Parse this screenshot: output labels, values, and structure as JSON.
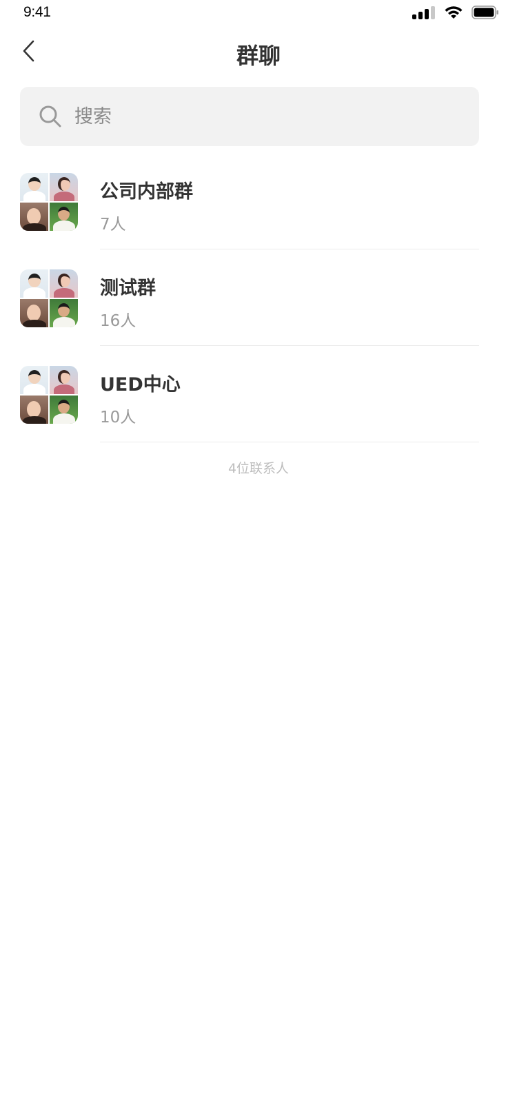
{
  "status_bar": {
    "time": "9:41"
  },
  "nav": {
    "title": "群聊"
  },
  "search": {
    "placeholder": "搜索"
  },
  "groups": [
    {
      "name": "公司内部群",
      "count": "7人"
    },
    {
      "name": "测试群",
      "count": "16人"
    },
    {
      "name": "UED中心",
      "count": "10人"
    }
  ],
  "footer": {
    "contacts_count": "4位联系人"
  },
  "icons": {
    "back": "chevron-left-icon",
    "search": "search-icon",
    "signal": "signal-icon",
    "wifi": "wifi-icon",
    "battery": "battery-icon"
  },
  "colors": {
    "title_text": "#333333",
    "secondary_text": "#999999",
    "search_bg": "#f2f2f2",
    "divider": "#ececec"
  }
}
